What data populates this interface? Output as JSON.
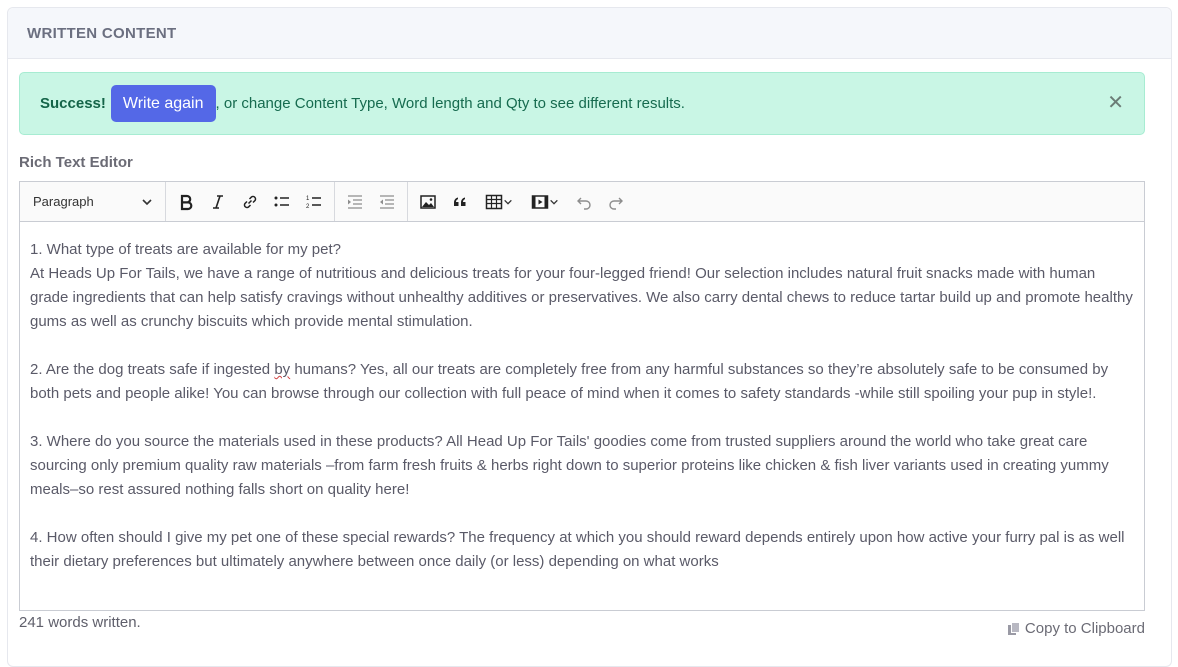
{
  "card": {
    "title": "WRITTEN CONTENT"
  },
  "alert": {
    "strong": "Success!",
    "button_label": "Write again",
    "message": ", or change Content Type, Word length and Qty to see different results.",
    "close_glyph": "✕"
  },
  "editor": {
    "label": "Rich Text Editor",
    "toolbar": {
      "heading_select": "Paragraph",
      "icons": [
        "bold-icon",
        "italic-icon",
        "link-icon",
        "bulleted-list-icon",
        "numbered-list-icon",
        "indent-icon",
        "outdent-icon",
        "image-icon",
        "blockquote-icon",
        "table-icon",
        "media-icon",
        "undo-icon",
        "redo-icon"
      ]
    },
    "paragraphs": [
      {
        "line1": "1. What type of treats are available for my pet?",
        "line2": "At Heads Up For Tails, we have a range of nutritious and delicious treats for your four-legged friend! Our selection includes natural fruit snacks made with human grade ingredients that can help satisfy cravings without unhealthy additives or preservatives. We also carry dental chews to reduce tartar build up and promote healthy gums as well as crunchy biscuits which provide mental stimulation."
      },
      {
        "before": "2. Are the dog treats safe if ingested ",
        "misspelled": "by",
        "after": " humans? Yes, all our treats are completely free from any harmful substances so they’re absolutely safe to be consumed by both pets and people alike! You can browse through our collection with full peace of mind when it comes to safety standards -while still spoiling your pup in style!."
      },
      {
        "text": "3. Where do you source the materials used in these products? All Head Up For Tails' goodies come from trusted suppliers around the world who take great care sourcing only premium quality raw materials –from farm fresh fruits & herbs right down to superior proteins like chicken & fish liver variants used in creating yummy meals–so rest assured nothing falls short on quality here!"
      },
      {
        "text": "4. How often should I give my pet one of these special rewards? The frequency at which you should reward depends entirely upon how active your furry pal is as well their dietary preferences but ultimately anywhere between once daily (or less) depending on what works"
      }
    ]
  },
  "footer": {
    "word_count": "241 words written.",
    "copy_label": "Copy to Clipboard"
  },
  "colors": {
    "accent": "#5468e7",
    "success_bg": "#c9f6e5",
    "success_text": "#166b4f"
  }
}
